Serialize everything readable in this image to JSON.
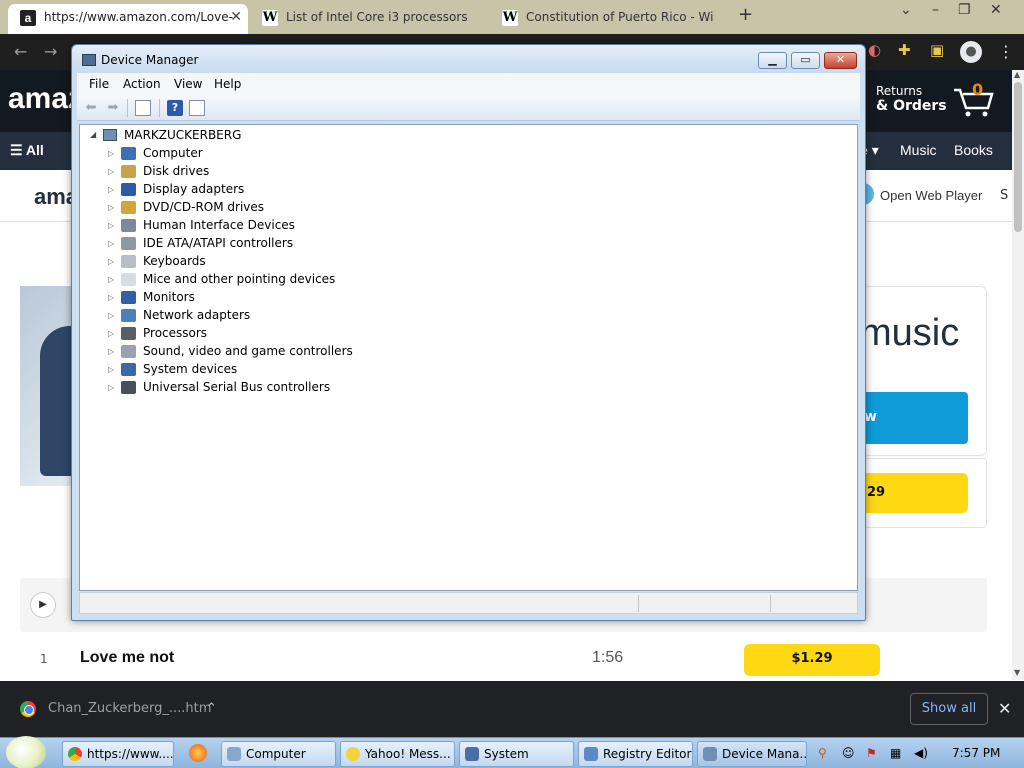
{
  "browser": {
    "tabs": [
      {
        "title": "https://www.amazon.com/Love-",
        "favicon": "amazon-a",
        "active": true
      },
      {
        "title": "List of Intel Core i3 processors",
        "favicon": "wikipedia-w",
        "active": false
      },
      {
        "title": "Constitution of Puerto Rico - Wi",
        "favicon": "wikipedia-w",
        "active": false
      }
    ],
    "new_tab_glyph": "+",
    "colors": {
      "tabstrip": "#c7c4a8",
      "toolbar": "#1f1f1f"
    }
  },
  "amazon": {
    "logo": "amaz",
    "returns_line1": "Returns",
    "returns_line2": "& Orders",
    "cart_count": "0",
    "nav_all": "All",
    "nav_items": [
      "e",
      "Music",
      "Books"
    ],
    "sub_logo": "ama",
    "open_web_player": "Open Web Player",
    "sub_truncated": "S",
    "hero_text": "music",
    "blue_button": "w",
    "yellow_button": ".29",
    "track": {
      "number": "1",
      "title": "Love me not",
      "duration": "1:56",
      "price": "$1.29"
    },
    "colors": {
      "header": "#131921",
      "nav": "#232f3e",
      "buy": "#ffd814",
      "listen": "#0f9bd7"
    }
  },
  "download_bar": {
    "file_name": "Chan_Zuckerberg_....htm",
    "show_all": "Show all"
  },
  "device_manager": {
    "title": "Device Manager",
    "menu": [
      "File",
      "Action",
      "View",
      "Help"
    ],
    "root": "MARKZUCKERBERG",
    "categories": [
      {
        "label": "Computer",
        "icon": "computer-icon"
      },
      {
        "label": "Disk drives",
        "icon": "disk-drive-icon"
      },
      {
        "label": "Display adapters",
        "icon": "display-adapter-icon"
      },
      {
        "label": "DVD/CD-ROM drives",
        "icon": "dvd-drive-icon"
      },
      {
        "label": "Human Interface Devices",
        "icon": "hid-icon"
      },
      {
        "label": "IDE ATA/ATAPI controllers",
        "icon": "ide-controller-icon"
      },
      {
        "label": "Keyboards",
        "icon": "keyboard-icon"
      },
      {
        "label": "Mice and other pointing devices",
        "icon": "mouse-icon"
      },
      {
        "label": "Monitors",
        "icon": "monitor-icon"
      },
      {
        "label": "Network adapters",
        "icon": "network-adapter-icon"
      },
      {
        "label": "Processors",
        "icon": "processor-icon"
      },
      {
        "label": "Sound, video and game controllers",
        "icon": "speaker-icon"
      },
      {
        "label": "System devices",
        "icon": "system-device-icon"
      },
      {
        "label": "Universal Serial Bus controllers",
        "icon": "usb-icon"
      }
    ]
  },
  "taskbar": {
    "buttons": [
      {
        "label": "https://www....",
        "icon": "chrome-icon"
      },
      {
        "label": "Computer",
        "icon": "computer-icon"
      },
      {
        "label": "Yahoo! Mess...",
        "icon": "yahoo-messenger-icon"
      },
      {
        "label": "System",
        "icon": "system-icon"
      },
      {
        "label": "Registry Editor",
        "icon": "registry-editor-icon"
      },
      {
        "label": "Device Mana...",
        "icon": "device-manager-icon"
      }
    ],
    "clock": "7:57 PM"
  }
}
